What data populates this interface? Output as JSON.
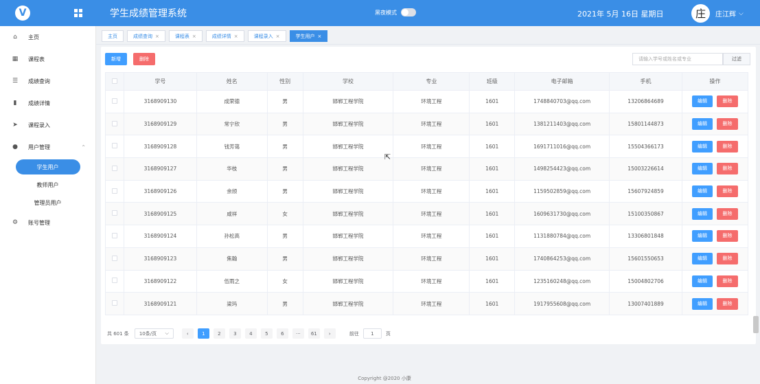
{
  "header": {
    "logo_letter": "V",
    "title": "学生成绩管理系统",
    "dark_mode_label": "黑夜模式",
    "date": "2021年 5月 16日   星期日",
    "avatar_char": "庄",
    "user_name": "庄江辉"
  },
  "sidebar": {
    "items": [
      {
        "label": "主页",
        "icon": "home-icon",
        "glyph": "⌂"
      },
      {
        "label": "课程表",
        "icon": "table-icon",
        "glyph": "▦"
      },
      {
        "label": "成绩查询",
        "icon": "list-icon",
        "glyph": "☰"
      },
      {
        "label": "成绩详情",
        "icon": "bar-chart-icon",
        "glyph": "▮"
      },
      {
        "label": "课程录入",
        "icon": "send-icon",
        "glyph": "➤"
      },
      {
        "label": "用户管理",
        "icon": "user-icon",
        "glyph": "●"
      },
      {
        "label": "账号管理",
        "icon": "gear-icon",
        "glyph": "⚙"
      }
    ],
    "sub_items": [
      "学生用户",
      "教师用户",
      "管理员用户"
    ]
  },
  "tabs": [
    {
      "label": "主页",
      "closable": false
    },
    {
      "label": "成绩查询",
      "closable": true
    },
    {
      "label": "课程表",
      "closable": true
    },
    {
      "label": "成绩详情",
      "closable": true
    },
    {
      "label": "课程录入",
      "closable": true
    },
    {
      "label": "学生用户",
      "closable": true,
      "active": true
    }
  ],
  "toolbar": {
    "add_label": "新增",
    "delete_label": "删除",
    "search_placeholder": "请输入学号或姓名或专业",
    "filter_label": "过滤"
  },
  "table": {
    "columns": [
      "学号",
      "姓名",
      "性别",
      "学校",
      "专业",
      "班级",
      "电子邮箱",
      "手机",
      "操作"
    ],
    "edit_label": "编辑",
    "delete_label": "删除",
    "rows": [
      [
        "3168909130",
        "成荣德",
        "男",
        "邯郸工程学院",
        "环境工程",
        "1601",
        "1748840703@qq.com",
        "13206864689"
      ],
      [
        "3168909129",
        "常宁欣",
        "男",
        "邯郸工程学院",
        "环境工程",
        "1601",
        "1381211403@qq.com",
        "15801144873"
      ],
      [
        "3168909128",
        "钱芳蔼",
        "男",
        "邯郸工程学院",
        "环境工程",
        "1601",
        "1691711016@qq.com",
        "15504366173"
      ],
      [
        "3168909127",
        "华枝",
        "男",
        "邯郸工程学院",
        "环境工程",
        "1601",
        "1498254423@qq.com",
        "15003226614"
      ],
      [
        "3168909126",
        "余颀",
        "男",
        "邯郸工程学院",
        "环境工程",
        "1601",
        "1159502859@qq.com",
        "15607924859"
      ],
      [
        "3168909125",
        "咸祥",
        "女",
        "邯郸工程学院",
        "环境工程",
        "1601",
        "1609631730@qq.com",
        "15100350867"
      ],
      [
        "3168909124",
        "孙松高",
        "男",
        "邯郸工程学院",
        "环境工程",
        "1601",
        "1131880784@qq.com",
        "13306801848"
      ],
      [
        "3168909123",
        "焦翰",
        "男",
        "邯郸工程学院",
        "环境工程",
        "1601",
        "1740864253@qq.com",
        "15601550653"
      ],
      [
        "3168909122",
        "伍雨之",
        "女",
        "邯郸工程学院",
        "环境工程",
        "1601",
        "1235160248@qq.com",
        "15004802706"
      ],
      [
        "3168909121",
        "梁玛",
        "男",
        "邯郸工程学院",
        "环境工程",
        "1601",
        "1917955608@qq.com",
        "13007401889"
      ]
    ]
  },
  "pagination": {
    "total_text": "共 601 条",
    "page_size": "10条/页",
    "prev": "‹",
    "next": "›",
    "pages": [
      "1",
      "2",
      "3",
      "4",
      "5",
      "6",
      "···",
      "61"
    ],
    "current": "1",
    "goto_label": "前往",
    "goto_value": "1",
    "goto_suffix": "页"
  },
  "footer": "Copyright @2020 小康"
}
